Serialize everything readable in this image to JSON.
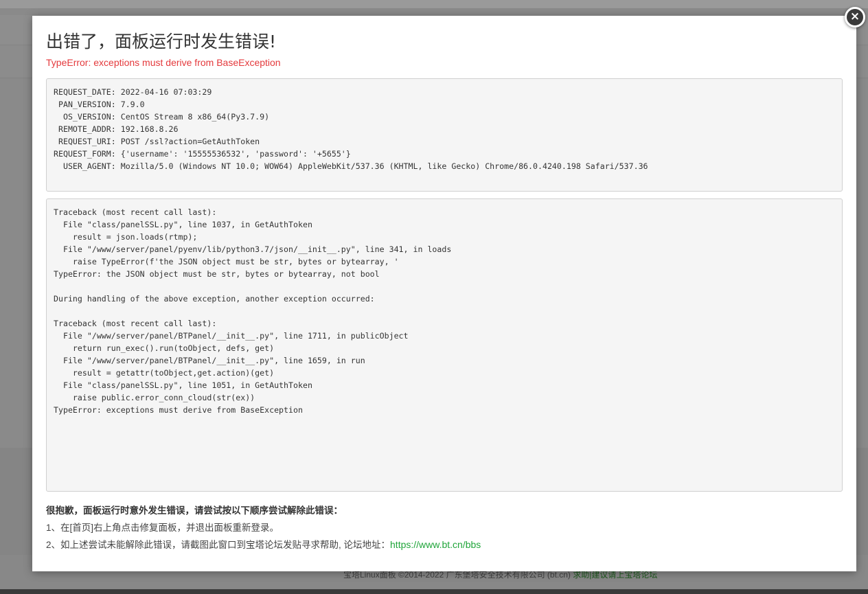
{
  "background": {
    "footer_text": "宝塔Linux面板 ©2014-2022 广东堡塔安全技术有限公司 (bt.cn)",
    "footer_link": "求助|建议请上宝塔论坛"
  },
  "dialog": {
    "close_label": "×",
    "title": "出错了，面板运行时发生错误!",
    "error_message": "TypeError: exceptions must derive from BaseException",
    "request_info": "REQUEST_DATE: 2022-04-16 07:03:29\n PAN_VERSION: 7.9.0\n  OS_VERSION: CentOS Stream 8 x86_64(Py3.7.9)\n REMOTE_ADDR: 192.168.8.26\n REQUEST_URI: POST /ssl?action=GetAuthToken\nREQUEST_FORM: {'username': '15555536532', 'password': '+5655'}\n  USER_AGENT: Mozilla/5.0 (Windows NT 10.0; WOW64) AppleWebKit/537.36 (KHTML, like Gecko) Chrome/86.0.4240.198 Safari/537.36",
    "traceback": "Traceback (most recent call last):\n  File \"class/panelSSL.py\", line 1037, in GetAuthToken\n    result = json.loads(rtmp);\n  File \"/www/server/panel/pyenv/lib/python3.7/json/__init__.py\", line 341, in loads\n    raise TypeError(f'the JSON object must be str, bytes or bytearray, '\nTypeError: the JSON object must be str, bytes or bytearray, not bool\n\nDuring handling of the above exception, another exception occurred:\n\nTraceback (most recent call last):\n  File \"/www/server/panel/BTPanel/__init__.py\", line 1711, in publicObject\n    return run_exec().run(toObject, defs, get)\n  File \"/www/server/panel/BTPanel/__init__.py\", line 1659, in run\n    result = getattr(toObject,get.action)(get)\n  File \"class/panelSSL.py\", line 1051, in GetAuthToken\n    raise public.error_conn_cloud(str(ex))\nTypeError: exceptions must derive from BaseException",
    "help_title": "很抱歉，面板运行时意外发生错误，请尝试按以下顺序尝试解除此错误：",
    "help_step1": "1、在[首页]右上角点击修复面板，并退出面板重新登录。",
    "help_step2": "2、如上述尝试未能解除此错误，请截图此窗口到宝塔论坛发贴寻求帮助, 论坛地址：",
    "forum_url": "https://www.bt.cn/bbs"
  },
  "colors": {
    "error_red": "#e4393c",
    "link_green": "#20a53a"
  }
}
